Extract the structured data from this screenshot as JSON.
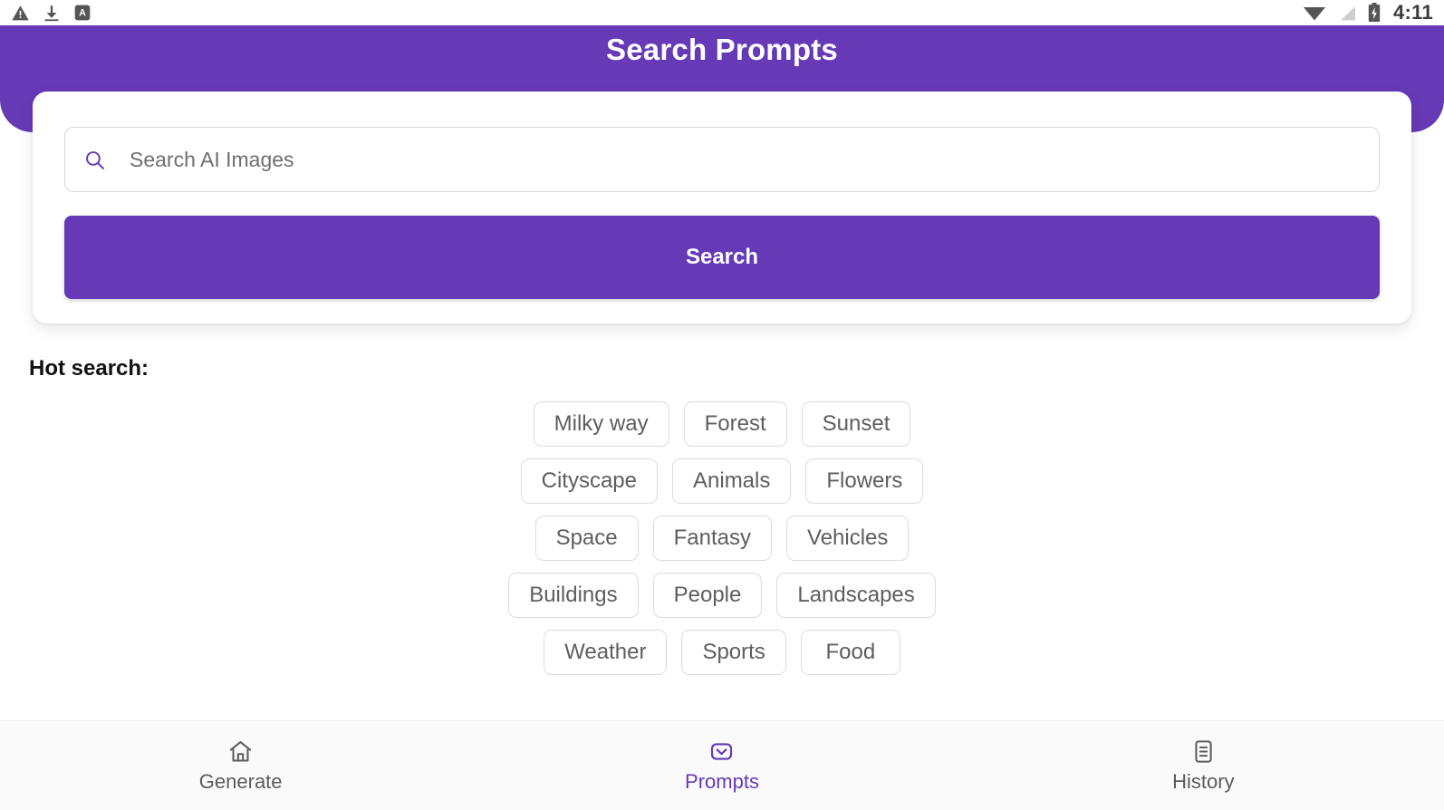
{
  "status_bar": {
    "icons_left": [
      "warning-triangle-icon",
      "download-icon",
      "app-badge-a-icon"
    ],
    "icons_right": [
      "wifi-icon",
      "cellular-signal-off-icon",
      "battery-charging-icon"
    ],
    "time": "4:11"
  },
  "header": {
    "title": "Search Prompts",
    "background_color": "#6639B7"
  },
  "search": {
    "icon": "search-icon",
    "placeholder": "Search AI Images",
    "value": "",
    "button_label": "Search",
    "button_color": "#6639B7"
  },
  "hot_search": {
    "label": "Hot search:",
    "rows": [
      [
        "Milky way",
        "Forest",
        "Sunset"
      ],
      [
        "Cityscape",
        "Animals",
        "Flowers"
      ],
      [
        "Space",
        "Fantasy",
        "Vehicles"
      ],
      [
        "Buildings",
        "People",
        "Landscapes"
      ],
      [
        "Weather",
        "Sports",
        "Food"
      ]
    ]
  },
  "bottom_nav": {
    "active_color": "#6639B7",
    "inactive_color": "#5c5c5c",
    "items": [
      {
        "label": "Generate",
        "icon": "home-icon",
        "active": false
      },
      {
        "label": "Prompts",
        "icon": "inbox-chevron-icon",
        "active": true
      },
      {
        "label": "History",
        "icon": "document-list-icon",
        "active": false
      }
    ]
  }
}
